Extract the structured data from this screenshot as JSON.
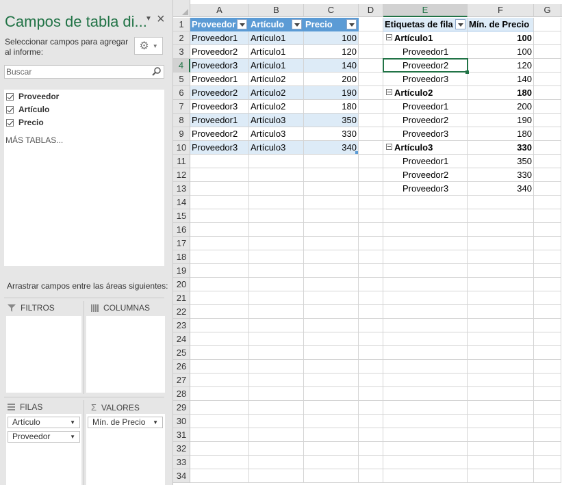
{
  "pane": {
    "title": "Campos de tabla di...",
    "instructions": "Seleccionar campos para agregar al informe:",
    "search_placeholder": "Buscar",
    "fields": [
      "Proveedor",
      "Artículo",
      "Precio"
    ],
    "more_tables": "MÁS TABLAS...",
    "drag_instructions": "Arrastrar campos entre las áreas siguientes:",
    "areas": {
      "filters": "FILTROS",
      "columns": "COLUMNAS",
      "rows": "FILAS",
      "values": "VALORES",
      "rows_items": [
        "Artículo",
        "Proveedor"
      ],
      "values_items": [
        "Mín. de Precio"
      ]
    }
  },
  "grid": {
    "columns": [
      "A",
      "B",
      "C",
      "D",
      "E",
      "F",
      "G"
    ],
    "row_numbers": [
      "1",
      "2",
      "3",
      "4",
      "5",
      "6",
      "7",
      "8",
      "9",
      "10",
      "11",
      "12",
      "13",
      "14",
      "15",
      "16",
      "17",
      "18",
      "19",
      "20",
      "21",
      "22",
      "23",
      "24",
      "25",
      "26",
      "27",
      "28",
      "29",
      "30",
      "31",
      "32",
      "33",
      "34"
    ],
    "table": {
      "headers": [
        "Proveedor",
        "Artículo",
        "Precio"
      ],
      "rows": [
        [
          "Proveedor1",
          "Artículo1",
          "100"
        ],
        [
          "Proveedor2",
          "Artículo1",
          "120"
        ],
        [
          "Proveedor3",
          "Artículo1",
          "140"
        ],
        [
          "Proveedor1",
          "Artículo2",
          "200"
        ],
        [
          "Proveedor2",
          "Artículo2",
          "190"
        ],
        [
          "Proveedor3",
          "Artículo2",
          "180"
        ],
        [
          "Proveedor1",
          "Artículo3",
          "350"
        ],
        [
          "Proveedor2",
          "Artículo3",
          "330"
        ],
        [
          "Proveedor3",
          "Artículo3",
          "340"
        ]
      ]
    },
    "pivot": {
      "row_label_header": "Etiquetas de fila",
      "value_header": "Mín. de Precio",
      "rows": [
        {
          "label": "Artículo1",
          "value": "100",
          "level": 0
        },
        {
          "label": "Proveedor1",
          "value": "100",
          "level": 1
        },
        {
          "label": "Proveedor2",
          "value": "120",
          "level": 1
        },
        {
          "label": "Proveedor3",
          "value": "140",
          "level": 1
        },
        {
          "label": "Artículo2",
          "value": "180",
          "level": 0
        },
        {
          "label": "Proveedor1",
          "value": "200",
          "level": 1
        },
        {
          "label": "Proveedor2",
          "value": "190",
          "level": 1
        },
        {
          "label": "Proveedor3",
          "value": "180",
          "level": 1
        },
        {
          "label": "Artículo3",
          "value": "330",
          "level": 0
        },
        {
          "label": "Proveedor1",
          "value": "350",
          "level": 1
        },
        {
          "label": "Proveedor2",
          "value": "330",
          "level": 1
        },
        {
          "label": "Proveedor3",
          "value": "340",
          "level": 1
        }
      ]
    },
    "active_cell": "E4",
    "colors": {
      "accent": "#217346",
      "table_header": "#5b9bd5",
      "band": "#ddebf7"
    }
  }
}
